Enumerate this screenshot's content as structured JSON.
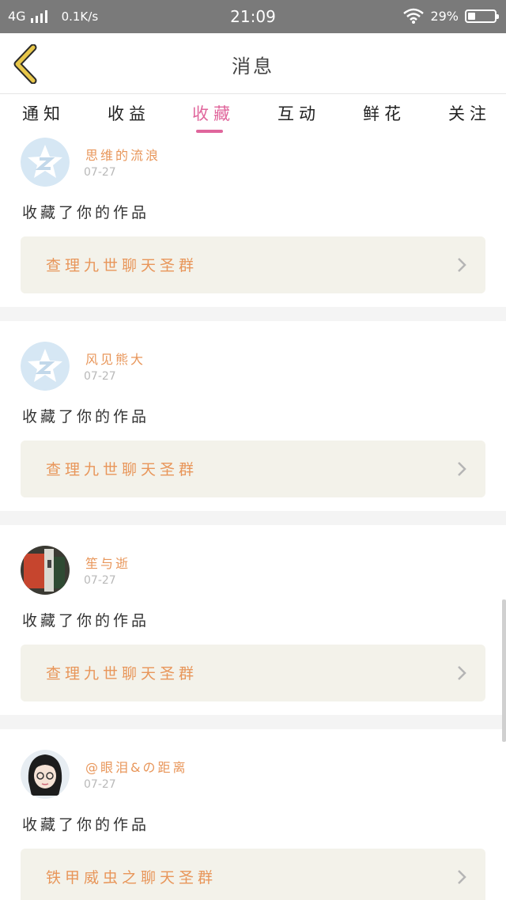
{
  "status": {
    "network": "4G",
    "speed": "0.1K/s",
    "time": "21:09",
    "battery": "29%",
    "battery_fraction": 0.29
  },
  "header": {
    "title": "消息"
  },
  "tabs": [
    {
      "label": "通知"
    },
    {
      "label": "收益"
    },
    {
      "label": "收藏"
    },
    {
      "label": "互动"
    },
    {
      "label": "鲜花"
    },
    {
      "label": "关注"
    }
  ],
  "active_tab": 2,
  "items": [
    {
      "user": "思维的流浪",
      "date": "07-27",
      "action": "收藏了你的作品",
      "work": "查理九世聊天圣群",
      "avatar": "qq-default-avatar"
    },
    {
      "user": "风见熊大",
      "date": "07-27",
      "action": "收藏了你的作品",
      "work": "查理九世聊天圣群",
      "avatar": "qq-default-avatar"
    },
    {
      "user": "笙与逝",
      "date": "07-27",
      "action": "收藏了你的作品",
      "work": "查理九世聊天圣群",
      "avatar": "photo-avatar"
    },
    {
      "user": "@眼泪&の距离",
      "date": "07-27",
      "action": "收藏了你的作品",
      "work": "铁甲威虫之聊天圣群",
      "avatar": "girl-avatar"
    }
  ],
  "colors": {
    "accent": "#e0669c",
    "username": "#e8965a",
    "work_bg": "#f3f2ea",
    "back_icon": "#e8c74a"
  }
}
